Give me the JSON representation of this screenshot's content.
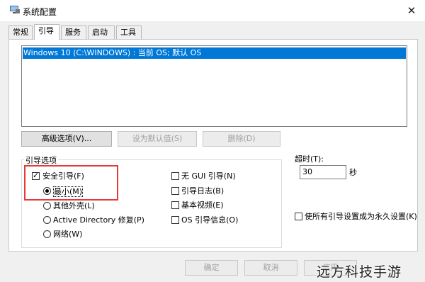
{
  "window": {
    "title": "系统配置",
    "close_glyph": "✕"
  },
  "tabs": [
    {
      "label": "常规"
    },
    {
      "label": "引导",
      "active": true
    },
    {
      "label": "服务"
    },
    {
      "label": "启动"
    },
    {
      "label": "工具"
    }
  ],
  "boot_entries": [
    {
      "label": "Windows 10 (C:\\WINDOWS) : 当前 OS; 默认 OS",
      "selected": true
    }
  ],
  "boot_buttons": {
    "advanced": "高级选项(V)...",
    "set_default": "设为默认值(S)",
    "delete": "删除(D)"
  },
  "boot_options": {
    "title": "引导选项",
    "safe_boot": {
      "label": "安全引导(F)",
      "checked": true
    },
    "radios": [
      {
        "label": "最小(M)",
        "checked": true
      },
      {
        "label": "其他外壳(L)",
        "checked": false
      },
      {
        "label": "Active Directory 修复(P)",
        "checked": false
      },
      {
        "label": "网络(W)",
        "checked": false
      }
    ],
    "right_checks": [
      {
        "label": "无 GUI 引导(N)",
        "checked": false
      },
      {
        "label": "引导日志(B)",
        "checked": false
      },
      {
        "label": "基本视频(E)",
        "checked": false
      },
      {
        "label": "OS 引导信息(O)",
        "checked": false
      }
    ]
  },
  "timeout": {
    "label": "超时(T):",
    "value": "30",
    "unit": "秒"
  },
  "permanent": {
    "label": "使所有引导设置成为永久设置(K)",
    "checked": false
  },
  "bottom_buttons": {
    "ok": "确定",
    "cancel": "取消",
    "apply": "应用"
  },
  "watermark": "远方科技手游",
  "colors": {
    "selection": "#0078d7",
    "highlight_box": "#e53935"
  }
}
